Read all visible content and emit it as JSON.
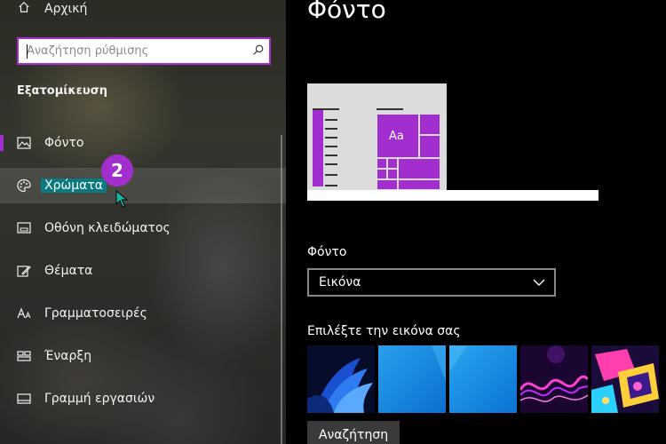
{
  "sidebar": {
    "home_label": "Αρχική",
    "search_placeholder": "Αναζήτηση ρύθμισης",
    "section_title": "Εξατομίκευση",
    "items": [
      {
        "label": "Φόντο",
        "icon": "picture-icon"
      },
      {
        "label": "Χρώματα",
        "icon": "palette-icon"
      },
      {
        "label": "Οθόνη κλειδώματος",
        "icon": "lock-screen-icon"
      },
      {
        "label": "Θέματα",
        "icon": "themes-icon"
      },
      {
        "label": "Γραμματοσειρές",
        "icon": "fonts-icon"
      },
      {
        "label": "Έναρξη",
        "icon": "start-icon"
      },
      {
        "label": "Γραμμή εργασιών",
        "icon": "taskbar-icon"
      }
    ],
    "step_badge": "2"
  },
  "main": {
    "title": "Φόντο",
    "preview_tile_text": "Aa",
    "background_label": "Φόντο",
    "background_value": "Εικόνα",
    "choose_label": "Επιλέξτε την εικόνα σας",
    "browse_label": "Αναζήτηση"
  },
  "colors": {
    "accent": "#a22ecf",
    "hover_highlight": "#0b7a80"
  }
}
